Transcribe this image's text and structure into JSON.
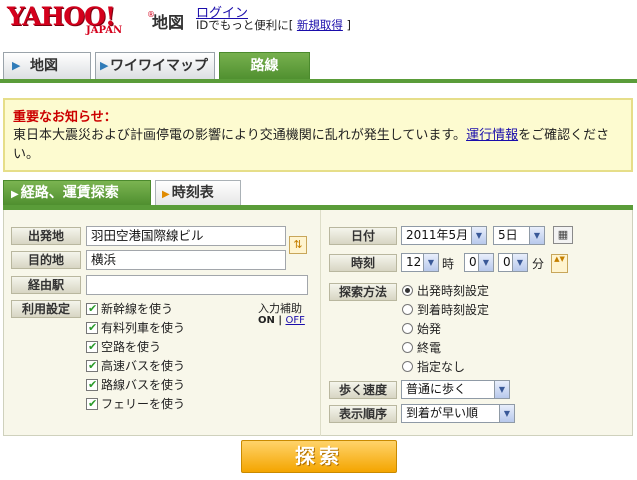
{
  "header": {
    "logo_text": "YAHOO!",
    "logo_sub": "JAPAN",
    "logo_reg": "®",
    "service_name": "地図",
    "login_link": "ログイン",
    "login_note_prefix": "IDでもっと便利に[ ",
    "register_link": "新規取得",
    "login_note_suffix": " ]"
  },
  "main_tabs": [
    {
      "label": "地図",
      "active": false
    },
    {
      "label": "ワイワイマップ",
      "active": false
    },
    {
      "label": "路線",
      "active": true
    }
  ],
  "notice": {
    "title": "重要なお知らせ：",
    "body_prefix": "東日本大震災および計画停電の影響により交通機関に乱れが発生しています。",
    "link": "運行情報",
    "body_suffix": "をご確認ください。"
  },
  "search_tabs": [
    {
      "label": "経路、運賃探索",
      "active": true
    },
    {
      "label": "時刻表",
      "active": false
    }
  ],
  "form": {
    "labels": {
      "from": "出発地",
      "to": "目的地",
      "via": "経由駅",
      "options": "利用設定",
      "date": "日付",
      "time": "時刻",
      "search_method": "探索方法",
      "walk_speed": "歩く速度",
      "sort_order": "表示順序"
    },
    "from_value": "羽田空港国際線ビル",
    "to_value": "横浜",
    "via_value": "",
    "options": [
      {
        "label": "新幹線を使う",
        "checked": true
      },
      {
        "label": "有料列車を使う",
        "checked": true
      },
      {
        "label": "空路を使う",
        "checked": true
      },
      {
        "label": "高速バスを使う",
        "checked": true
      },
      {
        "label": "路線バスを使う",
        "checked": true
      },
      {
        "label": "フェリーを使う",
        "checked": true
      }
    ],
    "input_assist": {
      "title": "入力補助",
      "on": "ON",
      "separator": "|",
      "off": "OFF"
    },
    "date": {
      "year_month": "2011年5月",
      "day": "5日"
    },
    "time": {
      "hour": "12",
      "hour_unit": "時",
      "min_tens": "0",
      "min_ones": "0",
      "min_unit": "分"
    },
    "search_methods": [
      {
        "label": "出発時刻設定",
        "selected": true
      },
      {
        "label": "到着時刻設定",
        "selected": false
      },
      {
        "label": "始発",
        "selected": false
      },
      {
        "label": "終電",
        "selected": false
      },
      {
        "label": "指定なし",
        "selected": false
      }
    ],
    "walk_speed_value": "普通に歩く",
    "sort_order_value": "到着が早い順",
    "search_button": "探索"
  },
  "icons": {
    "dropdown": "▼",
    "tab_arrow": "▶",
    "swap": "⇅",
    "calendar": "▦",
    "spin": "▲▼",
    "check": "✔"
  },
  "colors": {
    "yahoo_red": "#d4001c",
    "tab_green": "#5a9c39",
    "notice_bg": "#fdfbd0",
    "notice_title": "#cc0000",
    "search_button": "#f4a500"
  }
}
